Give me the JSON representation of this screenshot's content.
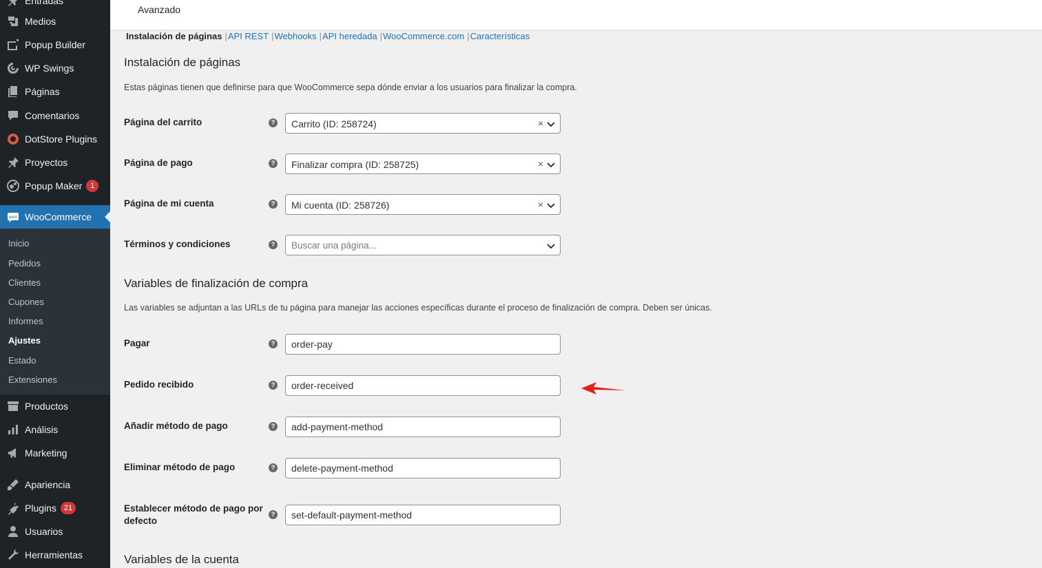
{
  "sidebar": {
    "items": [
      {
        "label": "Entradas",
        "icon": "pin-icon"
      },
      {
        "label": "Medios",
        "icon": "media-icon"
      },
      {
        "label": "Popup Builder",
        "icon": "popup-builder-icon"
      },
      {
        "label": "WP Swings",
        "icon": "wp-swings-icon"
      },
      {
        "label": "Páginas",
        "icon": "pages-icon"
      },
      {
        "label": "Comentarios",
        "icon": "comments-icon"
      },
      {
        "label": "DotStore Plugins",
        "icon": "dotstore-icon"
      },
      {
        "label": "Proyectos",
        "icon": "pin-icon"
      },
      {
        "label": "Popup Maker",
        "icon": "popup-maker-icon",
        "badge": "1"
      }
    ],
    "woocommerce": {
      "label": "WooCommerce",
      "icon": "woo-icon"
    },
    "submenu": [
      "Inicio",
      "Pedidos",
      "Clientes",
      "Cupones",
      "Informes",
      "Ajustes",
      "Estado",
      "Extensiones"
    ],
    "submenu_current": "Ajustes",
    "items_bottom": [
      {
        "label": "Productos",
        "icon": "products-icon"
      },
      {
        "label": "Análisis",
        "icon": "analytics-icon"
      },
      {
        "label": "Marketing",
        "icon": "megaphone-icon"
      },
      {
        "label": "Apariencia",
        "icon": "appearance-icon"
      },
      {
        "label": "Plugins",
        "icon": "plugins-icon",
        "badge": "21"
      },
      {
        "label": "Usuarios",
        "icon": "users-icon"
      },
      {
        "label": "Herramientas",
        "icon": "tools-icon"
      }
    ]
  },
  "topbar": {
    "tab": "Avanzado"
  },
  "subnav": {
    "current": "Instalación de páginas",
    "links": [
      "API REST",
      "Webhooks",
      "API heredada",
      "WooCommerce.com",
      "Características"
    ]
  },
  "page_setup": {
    "title": "Instalación de páginas",
    "description": "Estas páginas tienen que definirse para que WooCommerce sepa dónde enviar a los usuarios para finalizar la compra.",
    "fields": [
      {
        "label": "Página del carrito",
        "value": "Carrito (ID: 258724)",
        "clearable": true
      },
      {
        "label": "Página de pago",
        "value": "Finalizar compra (ID: 258725)",
        "clearable": true
      },
      {
        "label": "Página de mi cuenta",
        "value": "Mi cuenta (ID: 258726)",
        "clearable": true
      },
      {
        "label": "Términos y condiciones",
        "value": "",
        "placeholder": "Buscar una página...",
        "clearable": false
      }
    ],
    "clear_glyph": "×"
  },
  "checkout_endpoints": {
    "title": "Variables de finalización de compra",
    "description": "Las variables se adjuntan a las URLs de tu página para manejar las acciones específicas durante el proceso de finalización de compra. Deben ser únicas.",
    "fields": [
      {
        "label": "Pagar",
        "value": "order-pay"
      },
      {
        "label": "Pedido recibido",
        "value": "order-received"
      },
      {
        "label": "Añadir método de pago",
        "value": "add-payment-method"
      },
      {
        "label": "Eliminar método de pago",
        "value": "delete-payment-method"
      },
      {
        "label": "Establecer método de pago por defecto",
        "value": "set-default-payment-method"
      }
    ]
  },
  "account_endpoints": {
    "title": "Variables de la cuenta"
  },
  "help_glyph": "?",
  "colors": {
    "sidebar_bg": "#1d2327",
    "submenu_bg": "#2c3338",
    "accent": "#2271b1",
    "badge": "#d63638",
    "annotation_arrow": "#e0201b"
  }
}
